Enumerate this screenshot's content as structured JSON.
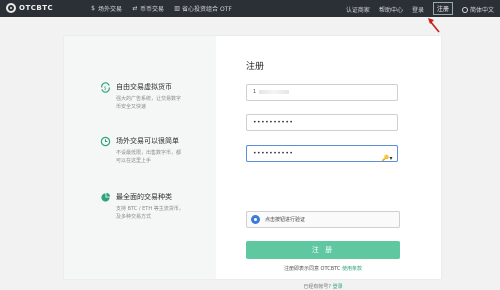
{
  "header": {
    "brand": "OTCBTC",
    "nav_left": [
      {
        "label": "场外交易",
        "icon": "dollar-icon"
      },
      {
        "label": "币币交易",
        "icon": "exchange-icon"
      },
      {
        "label": "省心投资组合 OTF",
        "icon": "chart-icon"
      }
    ],
    "merchant": "认证商家",
    "help": "帮助中心",
    "login": "登录",
    "register": "注册",
    "language": "简体中文"
  },
  "features": [
    {
      "title": "自由交易虚拟货币",
      "desc": [
        "强大的广告系统，让交易数字",
        "币安全又快速"
      ]
    },
    {
      "title": "场外交易可以很简单",
      "desc": [
        "不设最低限，出售数字币，都",
        "可以在这里上手"
      ]
    },
    {
      "title": "最全面的交易种类",
      "desc": [
        "支持 BTC / ETH 等主流货币，",
        "及多种交易方式"
      ]
    }
  ],
  "form": {
    "title": "注册",
    "email_value": "1",
    "password_value": "••••••••••",
    "confirm_value": "••••••••••",
    "captcha_label": "点击按钮进行验证",
    "submit_label": "注 册",
    "agree_prefix": "注册即表示同意 OTCBTC ",
    "agree_link": "使用条款",
    "login_prefix": "已经有帐号? ",
    "login_link": "登录"
  },
  "colors": {
    "accent": "#5fc8a1",
    "topbar": "#2b2f36",
    "arrow": "#c81e1e"
  }
}
